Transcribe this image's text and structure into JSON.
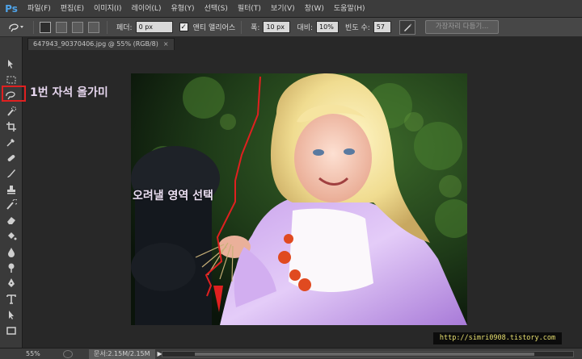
{
  "app": {
    "logo": "Ps"
  },
  "menu": [
    "파일(F)",
    "편집(E)",
    "이미지(I)",
    "레이어(L)",
    "유형(Y)",
    "선택(S)",
    "필터(T)",
    "보기(V)",
    "창(W)",
    "도움말(H)"
  ],
  "options": {
    "tool_preset_icon": "magnetic-lasso-icon",
    "feather_label": "페더:",
    "feather_value": "0 px",
    "antialias_checked": true,
    "antialias_label": "앤티 앨리어스",
    "width_label": "폭:",
    "width_value": "10 px",
    "contrast_label": "대비:",
    "contrast_value": "10%",
    "frequency_label": "빈도 수:",
    "frequency_value": "57",
    "pen_pressure_icon": "pen-pressure-icon",
    "refine_edge_label": "가장자리 다듬기..."
  },
  "document": {
    "tab_title": "647943_90370406.jpg @ 55% (RGB/8)",
    "tab_close": "×"
  },
  "annotations": {
    "tool_note": "1번 자석 올가미",
    "area_note": "오려낼 영역 선택",
    "watermark": "http://simri0908.tistory.com"
  },
  "status": {
    "zoom": "55%",
    "doc_info": "문서:2.15M/2.15M",
    "arrow": "▶"
  },
  "colors": {
    "annotation_red": "#e02020",
    "ps_blue": "#4fa3e8",
    "watermark_text": "#e8e070"
  }
}
